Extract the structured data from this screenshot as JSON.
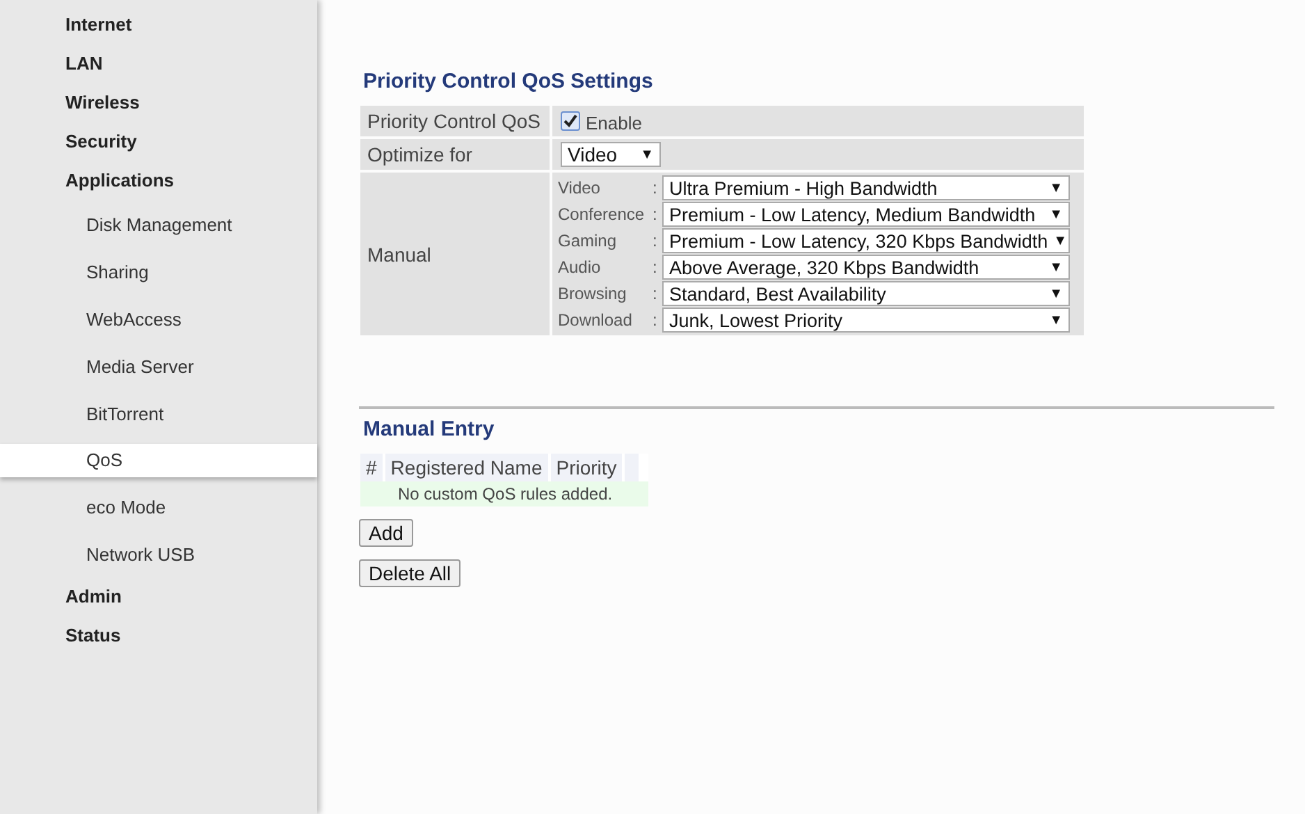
{
  "sidebar": {
    "items": [
      {
        "label": "Internet",
        "selected": false
      },
      {
        "label": "LAN",
        "selected": false
      },
      {
        "label": "Wireless",
        "selected": false
      },
      {
        "label": "Security",
        "selected": false
      },
      {
        "label": "Applications",
        "selected": false,
        "children": [
          {
            "label": "Disk Management",
            "selected": false
          },
          {
            "label": "Sharing",
            "selected": false
          },
          {
            "label": "WebAccess",
            "selected": false
          },
          {
            "label": "Media Server",
            "selected": false
          },
          {
            "label": "BitTorrent",
            "selected": false
          },
          {
            "label": "QoS",
            "selected": true
          },
          {
            "label": "eco Mode",
            "selected": false
          },
          {
            "label": "Network USB",
            "selected": false
          }
        ]
      },
      {
        "label": "Admin",
        "selected": false
      },
      {
        "label": "Status",
        "selected": false
      }
    ]
  },
  "settings": {
    "title": "Priority Control QoS Settings",
    "enable_row": {
      "label": "Priority Control QoS",
      "checkbox_label": "Enable",
      "checked": true
    },
    "optimize_row": {
      "label": "Optimize for",
      "value": "Video"
    },
    "manual_row": {
      "label": "Manual",
      "entries": [
        {
          "label": "Video",
          "separator": ":",
          "value": "Ultra Premium - High Bandwidth"
        },
        {
          "label": "Conference",
          "separator": ":",
          "value": "Premium - Low Latency, Medium Bandwidth"
        },
        {
          "label": "Gaming",
          "separator": ":",
          "value": "Premium - Low Latency, 320 Kbps Bandwidth"
        },
        {
          "label": "Audio",
          "separator": ":",
          "value": "Above Average, 320 Kbps Bandwidth"
        },
        {
          "label": "Browsing",
          "separator": ":",
          "value": "Standard, Best Availability"
        },
        {
          "label": "Download",
          "separator": ":",
          "value": "Junk, Lowest Priority"
        }
      ]
    },
    "dropdown_arrow": "▼"
  },
  "manual_entry": {
    "title": "Manual Entry",
    "columns": [
      "#",
      "Registered Name",
      "Priority"
    ],
    "empty_message": "No custom QoS rules added.",
    "buttons": [
      "Add",
      "Delete All"
    ]
  }
}
